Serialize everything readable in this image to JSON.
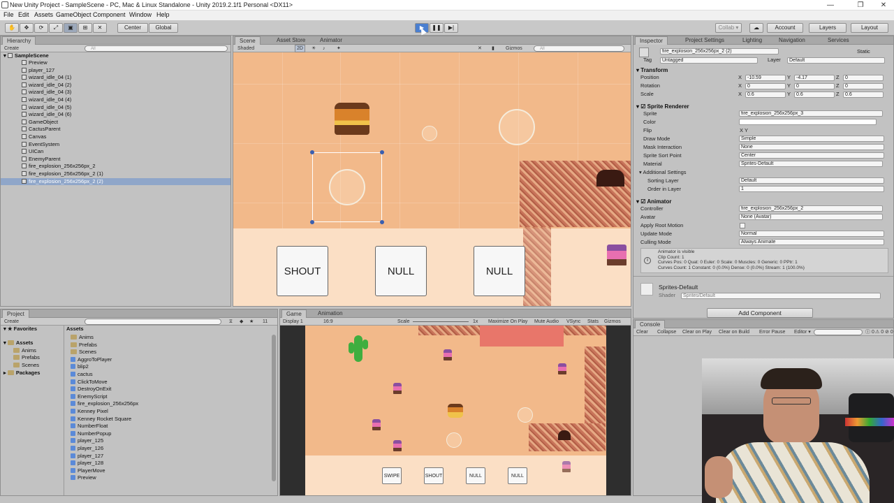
{
  "window": {
    "title": "New Unity Project - SampleScene - PC, Mac & Linux Standalone - Unity 2019.2.1f1 Personal <DX11>",
    "minimize": "—",
    "maximize": "❐",
    "close": "✕"
  },
  "menubar": [
    "File",
    "Edit",
    "Assets",
    "GameObject",
    "Component",
    "Window",
    "Help"
  ],
  "toolbar": {
    "center": "Center",
    "global": "Global",
    "collab": "Collab ▾",
    "account": "Account",
    "layers": "Layers",
    "layout": "Layout"
  },
  "hierarchy": {
    "tab": "Hierarchy",
    "create": "Create",
    "search_placeholder": "All",
    "scene": "SampleScene",
    "items": [
      "Preview",
      "player_127",
      "wizard_idle_04 (1)",
      "wizard_idle_04 (2)",
      "wizard_idle_04 (3)",
      "wizard_idle_04 (4)",
      "wizard_idle_04 (5)",
      "wizard_idle_04 (6)",
      "GameObject",
      "CactusParent",
      "Canvas",
      "EventSystem",
      "UICan",
      "EnemyParent",
      "fire_explosion_256x256px_2",
      "fire_explosion_256x256px_2 (1)",
      "fire_explosion_256x256px_2 (2)"
    ]
  },
  "scene": {
    "tabs": [
      "Scene",
      "Asset Store",
      "Animator"
    ],
    "shading": "Shaded",
    "mode2d": "2D",
    "gizmos": "Gizmos",
    "search_placeholder": "All",
    "cards": [
      "SHOUT",
      "NULL",
      "NULL"
    ]
  },
  "inspector": {
    "tabs": [
      "Inspector",
      "Project Settings",
      "Lighting",
      "Navigation",
      "Services"
    ],
    "object_name": "fire_explosion_256x256px_2 (2)",
    "static": "Static",
    "tag_label": "Tag",
    "tag": "Untagged",
    "layer_label": "Layer",
    "layer": "Default",
    "transform": {
      "title": "Transform",
      "position_label": "Position",
      "rotation_label": "Rotation",
      "scale_label": "Scale",
      "position": [
        "-10.59",
        "-4.17",
        "0"
      ],
      "rotation": [
        "0",
        "0",
        "0"
      ],
      "scale": [
        "0.6",
        "0.6",
        "0.6"
      ]
    },
    "sprite_renderer": {
      "title": "Sprite Renderer",
      "sprite_label": "Sprite",
      "sprite": "fire_explosion_256x256px_3",
      "color_label": "Color",
      "flip_label": "Flip",
      "flip": "X  Y",
      "draw_mode_label": "Draw Mode",
      "draw_mode": "Simple",
      "mask_label": "Mask Interaction",
      "mask": "None",
      "sort_point_label": "Sprite Sort Point",
      "sort_point": "Center",
      "material_label": "Material",
      "material": "Sprites-Default",
      "additional": "Additional Settings",
      "sorting_layer_label": "Sorting Layer",
      "sorting_layer": "Default",
      "order_label": "Order in Layer",
      "order": "1"
    },
    "animator": {
      "title": "Animator",
      "controller_label": "Controller",
      "controller": "fire_explosion_256x256px_2",
      "avatar_label": "Avatar",
      "avatar": "None (Avatar)",
      "root_motion_label": "Apply Root Motion",
      "update_mode_label": "Update Mode",
      "update_mode": "Normal",
      "culling_label": "Culling Mode",
      "culling": "Always Animate",
      "info_1": "Animator is visible",
      "info_2": "Clip Count: 1",
      "info_3": "Curves Pos: 0 Quat: 0 Euler: 0 Scale: 0 Muscles: 0 Generic: 0 PPtr: 1",
      "info_4": "Curves Count: 1 Constant: 0 (0.0%) Dense: 0 (0.0%) Stream: 1 (100.0%)"
    },
    "material_name": "Sprites-Default",
    "shader_label": "Shader",
    "shader": "Sprites/Default",
    "add_component": "Add Component"
  },
  "project": {
    "tab": "Project",
    "create": "Create",
    "favorites": "Favorites",
    "assets": "Assets",
    "folders": [
      "Anims",
      "Prefabs",
      "Scenes"
    ],
    "packages": "Packages",
    "assets_header": "Assets",
    "count": "11",
    "items": [
      "Anims",
      "Prefabs",
      "Scenes",
      "AggroToPlayer",
      "blip2",
      "cactus",
      "ClickToMove",
      "DestroyOnExit",
      "EnemyScript",
      "fire_explosion_256x256px",
      "Kenney Pixel",
      "Kenney Rocket Square",
      "NumberFloat",
      "NumberPopup",
      "player_125",
      "player_126",
      "player_127",
      "player_128",
      "PlayerMove",
      "Preview"
    ]
  },
  "game": {
    "tabs": [
      "Game",
      "Animation"
    ],
    "display": "Display 1",
    "aspect": "16:9",
    "scale_label": "Scale",
    "scale": "1x",
    "maximize": "Maximize On Play",
    "mute": "Mute Audio",
    "vsync": "VSync",
    "stats": "Stats",
    "gizmos": "Gizmos",
    "cards": [
      "SWIPE",
      "SHOUT",
      "NULL",
      "NULL"
    ]
  },
  "console": {
    "tab": "Console",
    "buttons": [
      "Clear",
      "Collapse",
      "Clear on Play",
      "Clear on Build",
      "Error Pause",
      "Editor ▾"
    ],
    "counts": [
      "0",
      "0",
      "0"
    ]
  },
  "colors": {
    "sand": "#f2b98a",
    "sand_light": "#fbdfc5",
    "selection": "#8fa6c9",
    "play_active": "#4a7fd0"
  }
}
